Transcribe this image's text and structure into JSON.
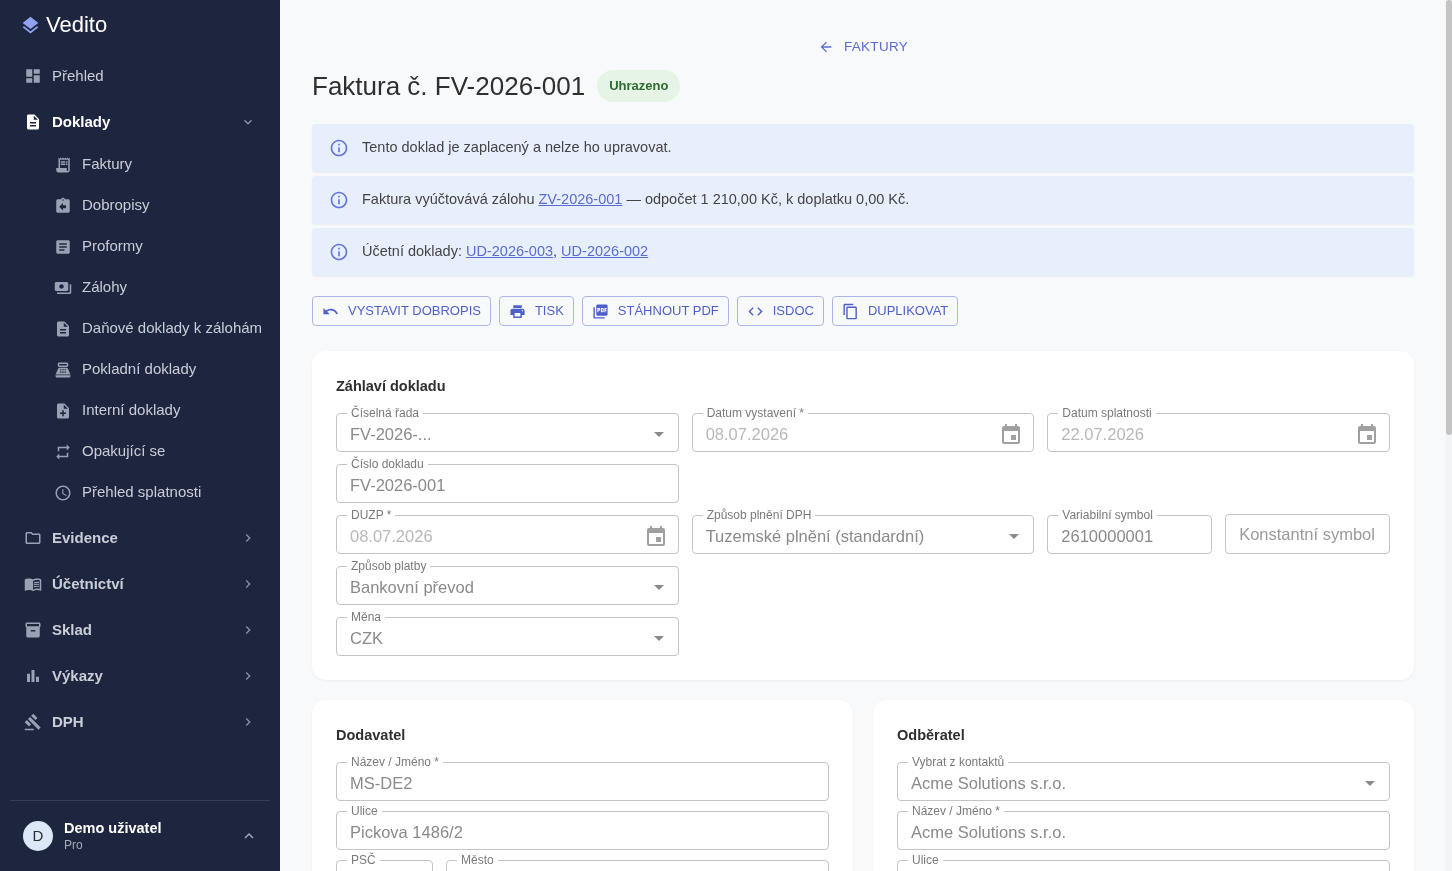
{
  "sidebar": {
    "logo": "Vedito",
    "nav": [
      {
        "kind": "link",
        "label": "Přehled",
        "selected": false
      },
      {
        "kind": "group",
        "label": "Doklady",
        "selected": true,
        "expanded": true,
        "children": [
          {
            "label": "Faktury",
            "selected": false
          },
          {
            "label": "Dobropisy",
            "selected": false
          },
          {
            "label": "Proformy",
            "selected": false
          },
          {
            "label": "Zálohy",
            "selected": false
          },
          {
            "label": "Daňové doklady k zálohám",
            "selected": false
          },
          {
            "label": "Pokladní doklady",
            "selected": false
          },
          {
            "label": "Interní doklady",
            "selected": false
          },
          {
            "label": "Opakující se",
            "selected": false
          },
          {
            "label": "Přehled splatnosti",
            "selected": false
          }
        ]
      },
      {
        "kind": "group",
        "label": "Evidence",
        "selected": false,
        "expanded": false
      },
      {
        "kind": "group",
        "label": "Účetnictví",
        "selected": false,
        "expanded": false
      },
      {
        "kind": "group",
        "label": "Sklad",
        "selected": false,
        "expanded": false
      },
      {
        "kind": "group",
        "label": "Výkazy",
        "selected": false,
        "expanded": false
      },
      {
        "kind": "group",
        "label": "DPH",
        "selected": false,
        "expanded": false
      }
    ],
    "user": {
      "initial": "D",
      "name": "Demo uživatel",
      "plan": "Pro"
    }
  },
  "header": {
    "back_link": "FAKTURY",
    "title": "Faktura č. FV-2026-001",
    "status": "Uhrazeno"
  },
  "alerts": [
    {
      "parts": [
        {
          "kind": "text",
          "text": "Tento doklad je zaplacený a nelze ho upravovat."
        }
      ]
    },
    {
      "parts": [
        {
          "kind": "text",
          "text": "Faktura vyúčtovává zálohu "
        },
        {
          "kind": "link",
          "text": "ZV-2026-001"
        },
        {
          "kind": "text",
          "text": " — odpočet 1 210,00 Kč, k doplatku 0,00 Kč."
        }
      ]
    },
    {
      "parts": [
        {
          "kind": "text",
          "text": "Účetní doklady: "
        },
        {
          "kind": "link",
          "text": "UD-2026-003"
        },
        {
          "kind": "text",
          "text": ", "
        },
        {
          "kind": "link",
          "text": "UD-2026-002"
        }
      ]
    }
  ],
  "actions": [
    "VYSTAVIT DOBROPIS",
    "TISK",
    "STÁHNOUT PDF",
    "ISDOC",
    "DUPLIKOVAT"
  ],
  "header_card": {
    "title": "Záhlaví dokladu",
    "rows": [
      [
        {
          "kind": "select",
          "label": "Číselná řada",
          "value": "FV-2026-..."
        },
        {
          "kind": "date",
          "label": "Datum vystavení *",
          "value": "08.07.2026"
        },
        {
          "kind": "date",
          "label": "Datum splatnosti",
          "value": "22.07.2026"
        }
      ],
      [
        {
          "kind": "text",
          "label": "Číslo dokladu",
          "value": "FV-2026-001"
        }
      ],
      [
        {
          "kind": "date",
          "label": "DUZP *",
          "value": "08.07.2026"
        },
        {
          "kind": "select",
          "label": "Způsob plnění DPH",
          "value": "Tuzemské plnění (standardní)"
        },
        {
          "kind": "text",
          "label": "Variabilní symbol",
          "value": "2610000001"
        },
        {
          "kind": "text",
          "placeholder": "Konstantní symbol"
        }
      ],
      [
        {
          "kind": "select",
          "label": "Způsob platby",
          "value": "Bankovní převod"
        }
      ],
      [
        {
          "kind": "select",
          "label": "Měna",
          "value": "CZK"
        }
      ]
    ]
  },
  "parties": [
    {
      "title": "Dodavatel",
      "rows": [
        [
          {
            "kind": "text",
            "label": "Název / Jméno *",
            "value": "MS-DE2"
          }
        ],
        [
          {
            "kind": "text",
            "label": "Ulice",
            "value": "Pickova 1486/2"
          }
        ],
        [
          {
            "kind": "text",
            "label": "PSČ"
          },
          {
            "kind": "text",
            "label": "Město"
          }
        ]
      ]
    },
    {
      "title": "Odběratel",
      "rows": [
        [
          {
            "kind": "select",
            "label": "Vybrat z kontaktů",
            "value": "Acme Solutions s.r.o."
          }
        ],
        [
          {
            "kind": "text",
            "label": "Název / Jméno *",
            "value": "Acme Solutions s.r.o."
          }
        ],
        [
          {
            "kind": "text",
            "label": "Ulice"
          }
        ]
      ]
    }
  ]
}
